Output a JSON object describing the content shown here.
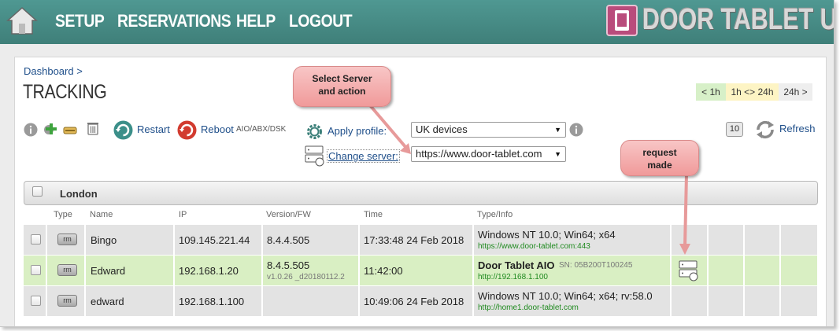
{
  "nav": {
    "home_icon": "home-icon",
    "items": [
      "SETUP",
      "RESERVATIONS",
      "HELP",
      "LOGOUT"
    ],
    "logo_text": "DOOR TABLET UI",
    "color": "#4a8f89"
  },
  "breadcrumb": "Dashboard >",
  "title": "TRACKING",
  "time_filters": [
    {
      "label": "< 1h",
      "color": "#d7f0c8"
    },
    {
      "label": "1h <> 24h",
      "color": "#fdf4c4"
    },
    {
      "label": "24h >",
      "color": "#eeeeee"
    }
  ],
  "toolbar": {
    "icons": [
      "info-icon",
      "add-icon",
      "edit-icon",
      "delete-icon"
    ],
    "restart_label": "Restart",
    "reboot_label": "Reboot",
    "reboot_suffix": "AIO/ABX/DSK",
    "apply_profile_label": "Apply profile:",
    "profile_selected": "UK devices",
    "change_server_label": "Change server:",
    "server_selected": "https://www.door-tablet.com",
    "count_badge": "10",
    "refresh_label": "Refresh"
  },
  "group": {
    "name": "London"
  },
  "table": {
    "columns": [
      "Type",
      "Name",
      "IP",
      "Version/FW",
      "Time",
      "Type/Info"
    ],
    "rows": [
      {
        "type_badge": "rm",
        "name": "Bingo",
        "ip": "109.145.221.44",
        "version": "8.4.4.505",
        "fw": "",
        "time": "17:33:48 24 Feb 2018",
        "info_main": "Windows NT 10.0; Win64; x64",
        "info_sn": "",
        "info_url": "https://www.door-tablet.com:443",
        "highlight": false
      },
      {
        "type_badge": "rm",
        "name": "Edward",
        "ip": "192.168.1.20",
        "version": "8.4.5.505",
        "fw": "v1.0.26 _d20180112.2",
        "time": "11:42:00",
        "info_main": "Door Tablet AIO",
        "info_sn": "SN: 05B200T100245",
        "info_url": "http://192.168.1.100",
        "highlight": true
      },
      {
        "type_badge": "rm",
        "name": "edward",
        "ip": "192.168.1.100",
        "version": "",
        "fw": "",
        "time": "10:49:06 24 Feb 2018",
        "info_main": "Windows NT 10.0; Win64; x64; rv:58.0",
        "info_sn": "",
        "info_url": "http://home1.door-tablet.com",
        "highlight": false
      }
    ]
  },
  "callouts": {
    "select_server": [
      "Select Server",
      "and action"
    ],
    "request_made": [
      "request",
      "made"
    ]
  },
  "colors": {
    "row_gray": "#e3e3e3",
    "row_green": "#d9efc3",
    "link": "#1f4f8a",
    "callout": "#f4b1b1"
  }
}
